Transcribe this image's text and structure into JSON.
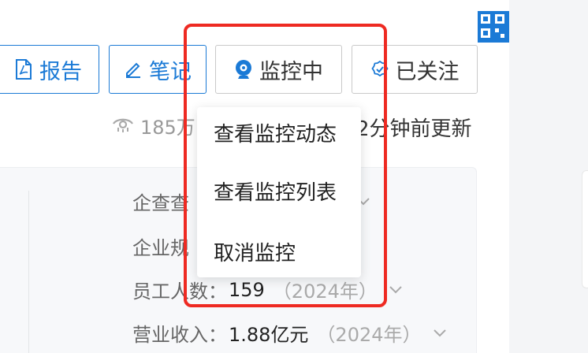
{
  "toolbar": {
    "report_label": "报告",
    "note_label": "笔记",
    "monitor_label": "监控中",
    "follow_label": "已关注"
  },
  "meta": {
    "views": "185万",
    "updated": "2分钟前更新"
  },
  "dropdown": {
    "items": [
      {
        "label": "查看监控动态"
      },
      {
        "label": "查看监控列表"
      },
      {
        "label": "取消监控"
      }
    ]
  },
  "info": {
    "row1_label": "企查查",
    "row2_label": "企业规",
    "employees_label": "员工人数：",
    "employees_value": "159",
    "employees_year": "（2024年）",
    "revenue_label": "营业收入：",
    "revenue_value": "1.88亿元",
    "revenue_year": "（2024年）"
  },
  "colors": {
    "accent": "#1b7ad6",
    "highlight": "#ee2a22"
  }
}
